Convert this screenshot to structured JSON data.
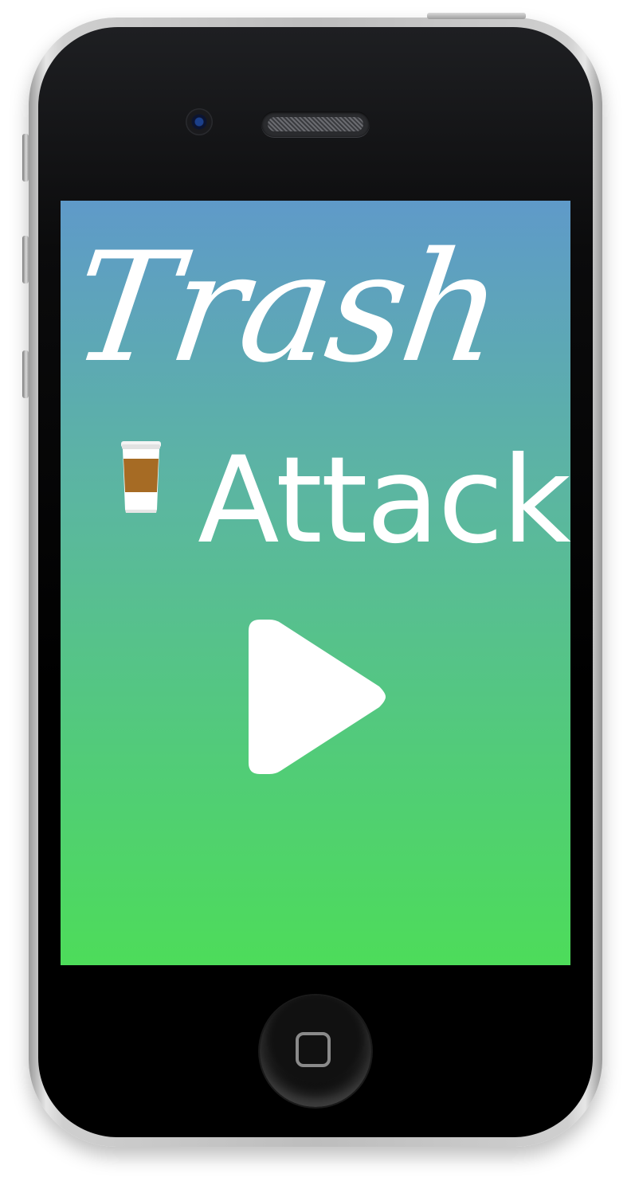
{
  "app": {
    "title_line1": "Trash",
    "title_line2": "Attack"
  },
  "icons": {
    "cup": "coffee-cup-icon",
    "play": "play-icon",
    "home": "home-button-square-icon",
    "camera": "front-camera",
    "speaker": "earpiece-speaker"
  },
  "colors": {
    "gradient_top": "#5f9ac9",
    "gradient_bottom": "#4ddc5a",
    "title": "#ffffff",
    "cup_sleeve": "#a86a22",
    "cup_body": "#ffffff"
  }
}
